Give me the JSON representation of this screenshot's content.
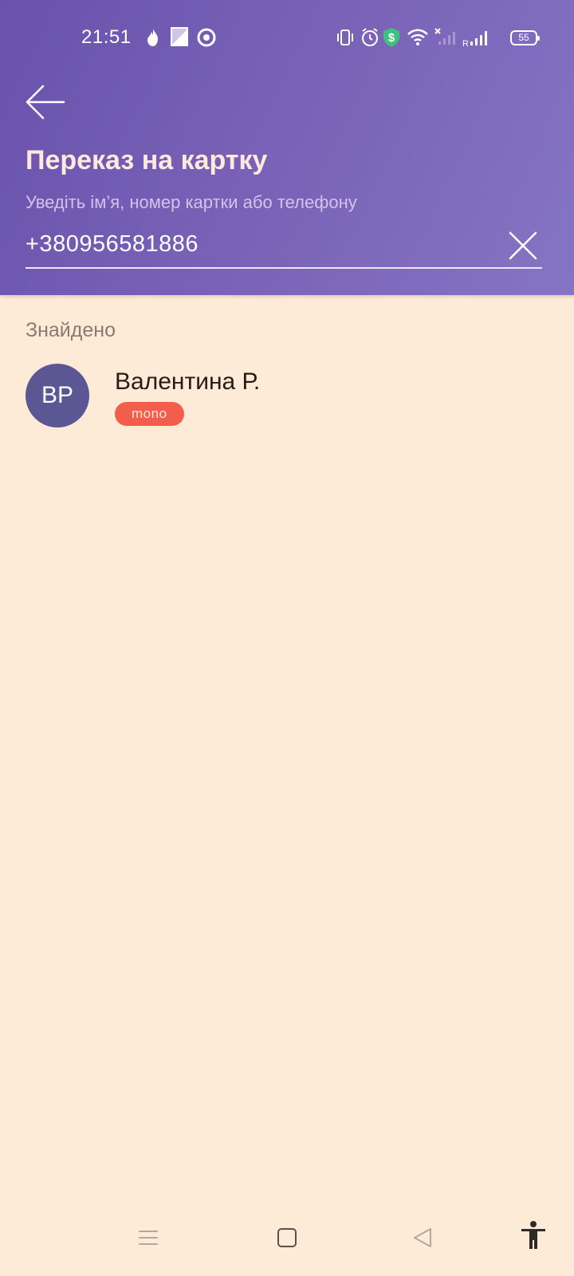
{
  "status_bar": {
    "time": "21:51",
    "battery": "55",
    "icons": [
      "fire-icon",
      "image-icon",
      "sync-icon",
      "vibrate-icon",
      "alarm-icon",
      "shield-dollar-icon",
      "wifi-icon",
      "signal-off-icon",
      "signal-roaming-icon",
      "battery-icon"
    ]
  },
  "header": {
    "title": "Переказ на картку",
    "hint": "Уведіть ім’я, номер картки або телефону",
    "search_value": "+380956581886"
  },
  "results": {
    "section_label": "Знайдено",
    "items": [
      {
        "initials": "ВР",
        "name": "Валентина Р.",
        "badge": "mono"
      }
    ]
  },
  "colors": {
    "header_start": "#6a52ad",
    "header_end": "#8574c4",
    "background": "#fdebd8",
    "avatar": "#5b5794",
    "badge": "#f35d4b"
  },
  "nav_bar": {
    "buttons": [
      "menu-icon",
      "home-icon",
      "back-icon",
      "accessibility-icon"
    ]
  }
}
